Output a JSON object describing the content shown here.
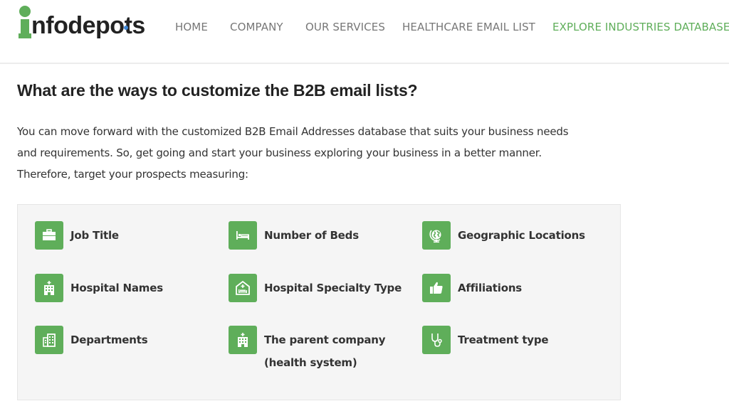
{
  "brand": {
    "logo_text": "nfodepots",
    "logo_letter": "i",
    "accent_color": "#5fae5a",
    "dot_color": "#3d86d6"
  },
  "nav": {
    "items": [
      {
        "label": "HOME",
        "active": false
      },
      {
        "label": "COMPANY",
        "active": false
      },
      {
        "label": "OUR SERVICES",
        "active": false
      },
      {
        "label": "HEALTHCARE EMAIL LIST",
        "active": false
      },
      {
        "label": "EXPLORE INDUSTRIES DATABASE",
        "active": true
      }
    ]
  },
  "content": {
    "heading": "What are the ways to customize the B2B email lists?",
    "intro_lines": [
      "You can move forward with the customized B2B Email Addresses database that suits your business needs",
      "and requirements. So, get going and start your business exploring your business in a better manner.",
      "Therefore, target your prospects measuring:"
    ]
  },
  "features": [
    {
      "label": "Job Title",
      "icon": "briefcase-icon"
    },
    {
      "label": "Number of Beds",
      "icon": "bed-icon"
    },
    {
      "label": "Geographic Locations",
      "icon": "globe-icon"
    },
    {
      "label": "Hospital Names",
      "icon": "hospital-icon"
    },
    {
      "label": "Hospital Specialty Type",
      "icon": "hospital-bed-icon"
    },
    {
      "label": "Affiliations",
      "icon": "thumbs-up-icon"
    },
    {
      "label": "Departments",
      "icon": "building-icon"
    },
    {
      "label": "The parent company",
      "label_line2": "(health system)",
      "icon": "hospital-icon"
    },
    {
      "label": "Treatment type",
      "icon": "stethoscope-icon"
    }
  ]
}
